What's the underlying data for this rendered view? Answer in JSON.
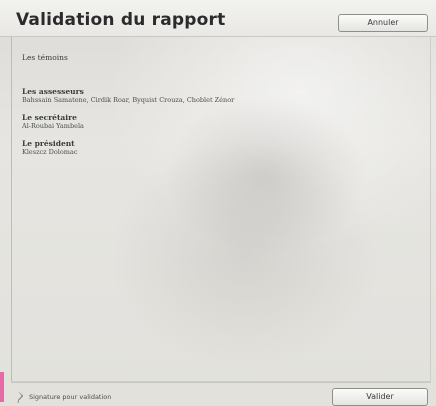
{
  "header": {
    "title": "Validation du rapport",
    "cancel_label": "Annuler"
  },
  "form": {
    "witnesses": {
      "label": "Les témoins"
    },
    "assessors": {
      "label": "Les assesseurs",
      "value": "Bahssain Samatene, Cirdik Roar, Byquist Crouza, Choblet Zénor"
    },
    "secretary": {
      "label": "Le secrétaire",
      "value": "Al-Roubai Yambela"
    },
    "president": {
      "label": "Le président",
      "value": "Kleszcz Dolomac"
    }
  },
  "footer": {
    "signature_label": "Signature pour validation",
    "validate_label": "Valider"
  },
  "icons": {
    "signature": "pen-icon"
  },
  "colors": {
    "accent": "#e66aa6"
  }
}
